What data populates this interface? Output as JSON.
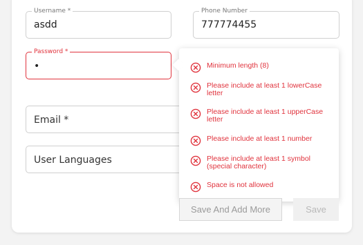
{
  "form": {
    "username": {
      "label": "Username *",
      "value": "asdd"
    },
    "phone": {
      "label": "Phone Number",
      "value": "777774455"
    },
    "password": {
      "label": "Password *",
      "value": "•"
    },
    "email": {
      "label": "Email *"
    },
    "languages": {
      "label": "User Languages"
    }
  },
  "password_rules": [
    {
      "text": "Minimum length (8)",
      "icon": "error-circle-x-icon"
    },
    {
      "text": "Please include at least 1 lowerCase letter",
      "icon": "error-circle-x-icon"
    },
    {
      "text": "Please include at least 1 upperCase letter",
      "icon": "error-circle-x-icon"
    },
    {
      "text": "Please include at least 1 number",
      "icon": "error-circle-x-icon"
    },
    {
      "text": "Please include at least 1 symbol (special character)",
      "icon": "error-circle-x-icon"
    },
    {
      "text": "Space is not allowed",
      "icon": "error-circle-x-icon"
    }
  ],
  "buttons": {
    "save_add_more": "Save And Add More",
    "save": "Save"
  },
  "colors": {
    "error": "#e0323c",
    "border": "#cfcfcf",
    "button_disabled_text": "#9a9a9a"
  }
}
